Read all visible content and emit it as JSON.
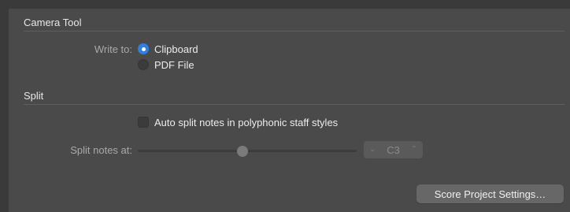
{
  "camera_tool": {
    "title": "Camera Tool",
    "write_to_label": "Write to:",
    "options": [
      {
        "label": "Clipboard",
        "selected": true
      },
      {
        "label": "PDF File",
        "selected": false
      }
    ]
  },
  "split": {
    "title": "Split",
    "auto_split_label": "Auto split notes in polyphonic staff styles",
    "auto_split_checked": false,
    "split_at_label": "Split notes at:",
    "split_note": "C3",
    "slider_value_fraction": 0.48
  },
  "footer": {
    "score_settings_button": "Score Project Settings…"
  },
  "colors": {
    "background": "#4a4a4a",
    "accent": "#2f7fe3"
  }
}
